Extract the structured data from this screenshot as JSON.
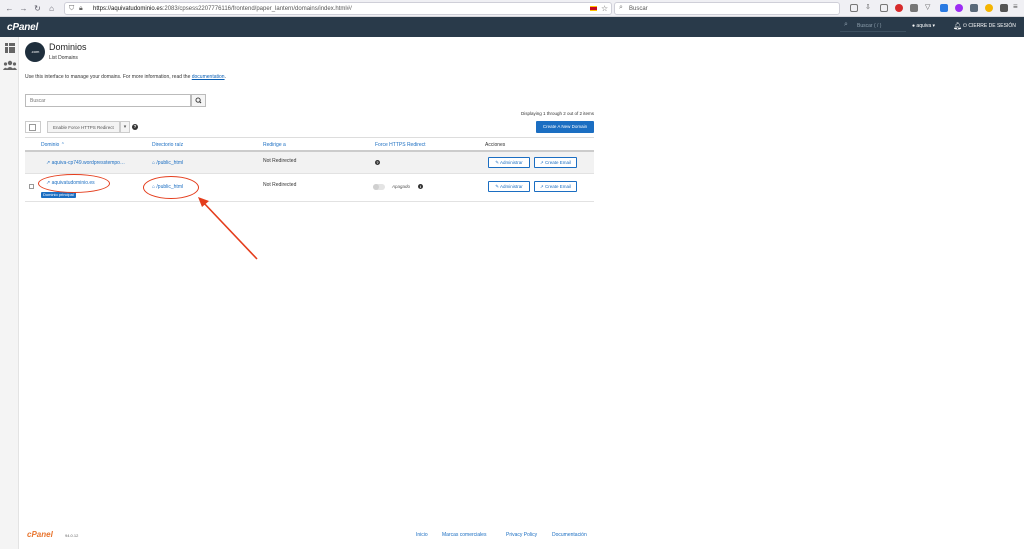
{
  "browser": {
    "url_host": "https://aquivatudominio.es",
    "url_path": ":2083/cpsess2207776116/frontend/paper_lantern/domains/index.html#/",
    "search_placeholder": "Buscar"
  },
  "header": {
    "logo": "cPanel",
    "search_placeholder": "Buscar ( / )",
    "user": "aquiva",
    "logout": "CIERRE DE SESIÓN"
  },
  "page": {
    "icon_text": ".com",
    "title": "Dominios",
    "subtitle": "List Domains",
    "description": "Use this interface to manage your domains. For more information, read the",
    "doc_link": "documentation",
    "search_placeholder": "Buscar",
    "displaying": "Displaying 1 through 2 out of 2 items",
    "force_https_button": "Enable Force HTTPS Redirect",
    "create_button": "Create A New Domain"
  },
  "table": {
    "headers": {
      "domain": "Dominio",
      "root": "Directorio raíz",
      "redirect": "Redirige a",
      "force": "Force HTTPS Redirect",
      "actions": "Acciones"
    },
    "rows": [
      {
        "domain": "aquiva-cp749.wordpresstempo…",
        "root": "/public_html",
        "redirect": "Not Redirected",
        "force": "",
        "manage": "Administrar",
        "email": "Create Email"
      },
      {
        "domain": "aquivatudominio.es",
        "badge": "Dominio principal",
        "root": "/public_html",
        "redirect": "Not Redirected",
        "force": "Apagado",
        "manage": "Administrar",
        "email": "Create Email"
      }
    ]
  },
  "footer": {
    "logo": "cPanel",
    "version": "94.0.12",
    "links": [
      "Inicio",
      "Marcas comerciales",
      "Privacy Policy",
      "Documentación"
    ]
  },
  "colors": {
    "header": "#293a4a",
    "accent": "#1b6ec2",
    "annotation": "#e43d1c"
  }
}
